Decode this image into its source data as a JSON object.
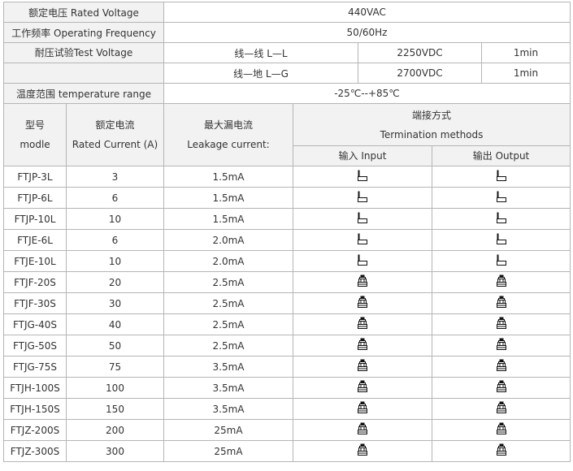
{
  "specs": {
    "rated_voltage": {
      "label": "额定电压 Rated Voltage",
      "value": "440VAC"
    },
    "operating_frequency": {
      "label": "工作频率 Operating Frequency",
      "value": "50/60Hz"
    },
    "test_voltage": {
      "label": "耐压试验Test Voltage",
      "rows": [
        {
          "mode": "线—线  L—L",
          "voltage": "2250VDC",
          "duration": "1min"
        },
        {
          "mode": "线—地  L—G",
          "voltage": "2700VDC",
          "duration": "1min"
        }
      ]
    },
    "temperature_range": {
      "label": "温度范围  temperature range",
      "value": "-25℃--+85℃"
    }
  },
  "headers": {
    "model_cn": "型号",
    "model_en": "modle",
    "current_cn": "额定电流",
    "current_en": "Rated Current (A)",
    "leakage_cn": "最大漏电流",
    "leakage_en": "Leakage current:",
    "termination_cn": "端接方式",
    "termination_en": "Termination methods",
    "input": "输入 Input",
    "output": "输出 Output"
  },
  "rows": [
    {
      "model": "FTJP-3L",
      "current": "3",
      "leakage": "1.5mA",
      "input_icon": "solder-lug-icon",
      "output_icon": "solder-lug-icon"
    },
    {
      "model": "FTJP-6L",
      "current": "6",
      "leakage": "1.5mA",
      "input_icon": "solder-lug-icon",
      "output_icon": "solder-lug-icon"
    },
    {
      "model": "FTJP-10L",
      "current": "10",
      "leakage": "1.5mA",
      "input_icon": "solder-lug-icon",
      "output_icon": "solder-lug-icon"
    },
    {
      "model": "FTJE-6L",
      "current": "6",
      "leakage": "2.0mA",
      "input_icon": "solder-lug-icon",
      "output_icon": "solder-lug-icon"
    },
    {
      "model": "FTJE-10L",
      "current": "10",
      "leakage": "2.0mA",
      "input_icon": "solder-lug-icon",
      "output_icon": "solder-lug-icon"
    },
    {
      "model": "FTJF-20S",
      "current": "20",
      "leakage": "2.5mA",
      "input_icon": "screw-terminal-icon",
      "output_icon": "screw-terminal-icon"
    },
    {
      "model": "FTJF-30S",
      "current": "30",
      "leakage": "2.5mA",
      "input_icon": "screw-terminal-icon",
      "output_icon": "screw-terminal-icon"
    },
    {
      "model": "FTJG-40S",
      "current": "40",
      "leakage": "2.5mA",
      "input_icon": "screw-terminal-icon",
      "output_icon": "screw-terminal-icon"
    },
    {
      "model": "FTJG-50S",
      "current": "50",
      "leakage": "2.5mA",
      "input_icon": "screw-terminal-icon",
      "output_icon": "screw-terminal-icon"
    },
    {
      "model": "FTJG-75S",
      "current": "75",
      "leakage": "3.5mA",
      "input_icon": "screw-terminal-icon",
      "output_icon": "screw-terminal-icon"
    },
    {
      "model": "FTJH-100S",
      "current": "100",
      "leakage": "3.5mA",
      "input_icon": "screw-terminal-icon",
      "output_icon": "screw-terminal-icon"
    },
    {
      "model": "FTJH-150S",
      "current": "150",
      "leakage": "3.5mA",
      "input_icon": "screw-terminal-icon",
      "output_icon": "screw-terminal-icon"
    },
    {
      "model": "FTJZ-200S",
      "current": "200",
      "leakage": "25mA",
      "input_icon": "screw-terminal-icon",
      "output_icon": "screw-terminal-icon"
    },
    {
      "model": "FTJZ-300S",
      "current": "300",
      "leakage": "25mA",
      "input_icon": "screw-terminal-icon",
      "output_icon": "screw-terminal-icon"
    }
  ]
}
